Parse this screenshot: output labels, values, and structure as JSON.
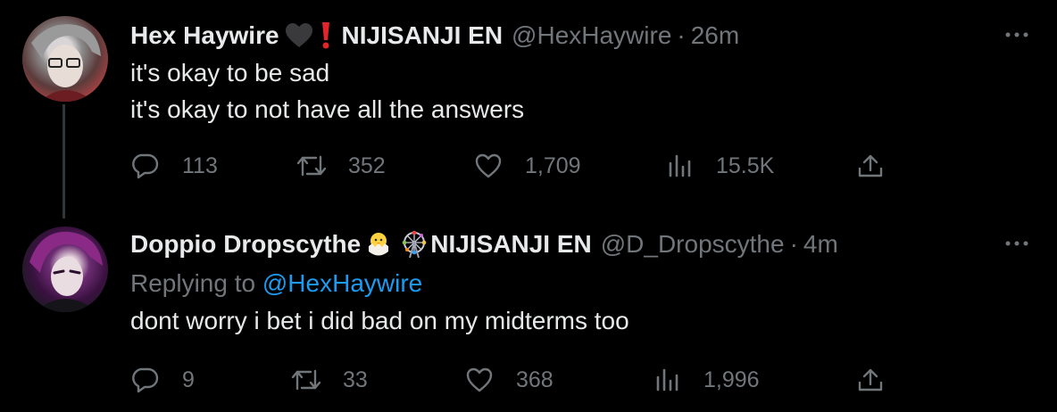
{
  "tweets": [
    {
      "name": "Hex Haywire",
      "affiliation": "NIJISANJI EN",
      "handle": "@HexHaywire",
      "time": "26m",
      "dot": "·",
      "lines": [
        "it's okay to be sad",
        "it's okay to not have all the answers"
      ],
      "stats": {
        "replies": "113",
        "retweets": "352",
        "likes": "1,709",
        "views": "15.5K"
      },
      "badges": [
        "black-heart-icon",
        "red-exclamation-icon"
      ]
    },
    {
      "name": "Doppio Dropscythe",
      "affiliation": "NIJISANJI EN",
      "handle": "@D_Dropscythe",
      "time": "4m",
      "dot": "·",
      "replying_prefix": "Replying to ",
      "replying_to": "@HexHaywire",
      "lines": [
        "dont worry i bet i did bad on my midterms too"
      ],
      "stats": {
        "replies": "9",
        "retweets": "33",
        "likes": "368",
        "views": "1,996"
      },
      "badges": [
        "hatching-chick-icon",
        "ferris-wheel-icon"
      ]
    }
  ],
  "colors": {
    "background": "#000000",
    "text": "#e7e9ea",
    "muted": "#71767b",
    "link": "#1d9bf0",
    "thread_line": "#333639"
  }
}
